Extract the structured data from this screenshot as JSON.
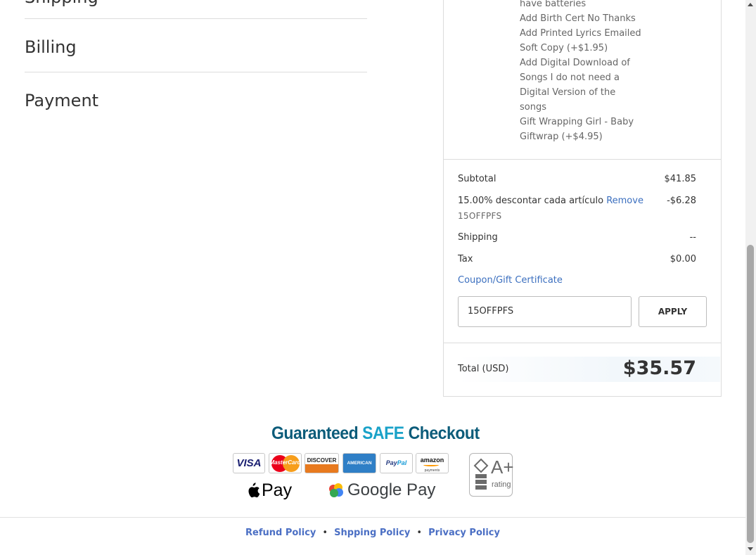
{
  "steps": {
    "shipping": "Shipping",
    "billing": "Billing",
    "payment": "Payment"
  },
  "item_options": [
    "have batteries",
    "Add Birth Cert No Thanks",
    "Add Printed Lyrics Emailed",
    "Soft Copy (+$1.95)",
    "Add Digital Download of",
    "Songs I do not need a",
    "Digital Version of the",
    "songs",
    "Gift Wrapping Girl - Baby",
    "Giftwrap (+$4.95)"
  ],
  "summary": {
    "subtotal_label": "Subtotal",
    "subtotal_value": "$41.85",
    "discount_label": "15.00% descontar cada artículo",
    "discount_remove": "Remove",
    "discount_code": "15OFFPFS",
    "discount_value": "-$6.28",
    "shipping_label": "Shipping",
    "shipping_value": "--",
    "tax_label": "Tax",
    "tax_value": "$0.00",
    "coupon_link": "Coupon/Gift Certificate",
    "coupon_input_value": "15OFFPFS",
    "apply_label": "APPLY",
    "total_label": "Total (USD)",
    "total_value": "$35.57"
  },
  "trust": {
    "title_part1": "Guaranteed ",
    "title_safe": "SAFE",
    "title_part2": " Checkout",
    "cards": {
      "visa": "VISA",
      "mastercard": "MasterCard",
      "discover": "DISCOVER",
      "amex": "AMERICAN EXPRESS",
      "paypal_a": "Pay",
      "paypal_b": "Pal",
      "amazon": "amazon",
      "amazon_sub": "payments"
    },
    "apple_pay": "Pay",
    "google_pay": "Google Pay",
    "bbb_grade": "A+",
    "bbb_rating": "rating"
  },
  "footer": {
    "refund": "Refund Policy",
    "shipping": "Shpping Policy",
    "privacy": "Privacy Policy",
    "separator": "•"
  },
  "colors": {
    "link": "#3b6fbf",
    "footer_link": "#4b6fc4",
    "safe_title": "#0c5c7a",
    "safe_accent": "#1aa2c8"
  }
}
